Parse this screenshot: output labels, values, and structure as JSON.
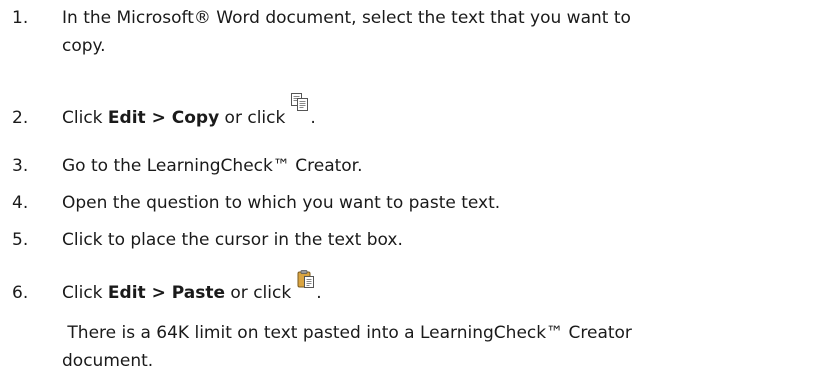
{
  "steps": [
    {
      "number": "1.",
      "line1": "In the Microsoft® Word document, select the text that you want to",
      "line2": "copy."
    },
    {
      "number": "2.",
      "pre": "Click ",
      "bold": "Edit > Copy",
      "mid": " or click",
      "post": ".",
      "icon": "copy-icon"
    },
    {
      "number": "3.",
      "text": "Go to the LearningCheck™ Creator."
    },
    {
      "number": "4.",
      "text": "Open the question to which you want to paste text."
    },
    {
      "number": "5.",
      "text": "Click to place the cursor in the text box."
    },
    {
      "number": "6.",
      "pre": "Click ",
      "bold": "Edit > Paste",
      "mid": " or click",
      "post": ".",
      "icon": "paste-icon"
    }
  ],
  "note": {
    "line1": " There is a 64K limit on text pasted into a LearningCheck™ Creator",
    "line2": "document."
  }
}
